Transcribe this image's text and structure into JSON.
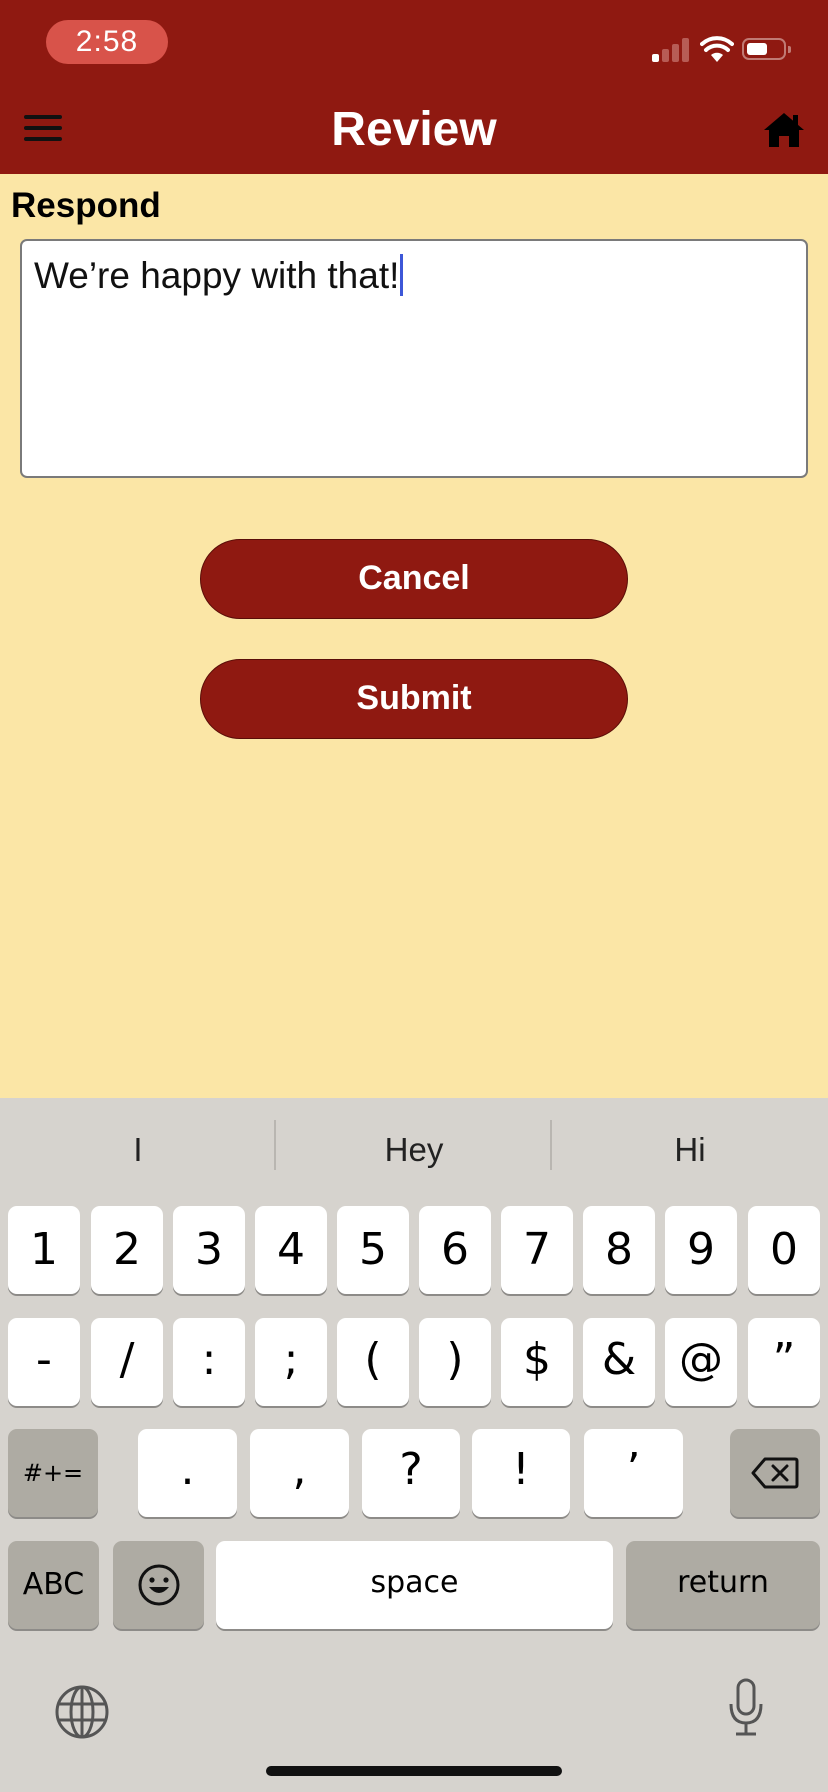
{
  "status_bar": {
    "time": "2:58"
  },
  "nav": {
    "title": "Review"
  },
  "form": {
    "label": "Respond",
    "response_value": "We’re happy with that!",
    "cancel_label": "Cancel",
    "submit_label": "Submit"
  },
  "keyboard": {
    "suggestions": [
      "I",
      "Hey",
      "Hi"
    ],
    "row1": [
      "1",
      "2",
      "3",
      "4",
      "5",
      "6",
      "7",
      "8",
      "9",
      "0"
    ],
    "row2": [
      "-",
      "/",
      ":",
      ";",
      "(",
      ")",
      "$",
      "&",
      "@",
      "”"
    ],
    "row3": {
      "symbols_toggle": "#+=",
      "keys": [
        ".",
        ",",
        "?",
        "!",
        "’"
      ]
    },
    "row4": {
      "abc": "ABC",
      "space": "space",
      "return": "return"
    }
  },
  "colors": {
    "brand_red": "#8f1911",
    "background": "#fbe6a6",
    "caret": "#3d57d8"
  }
}
